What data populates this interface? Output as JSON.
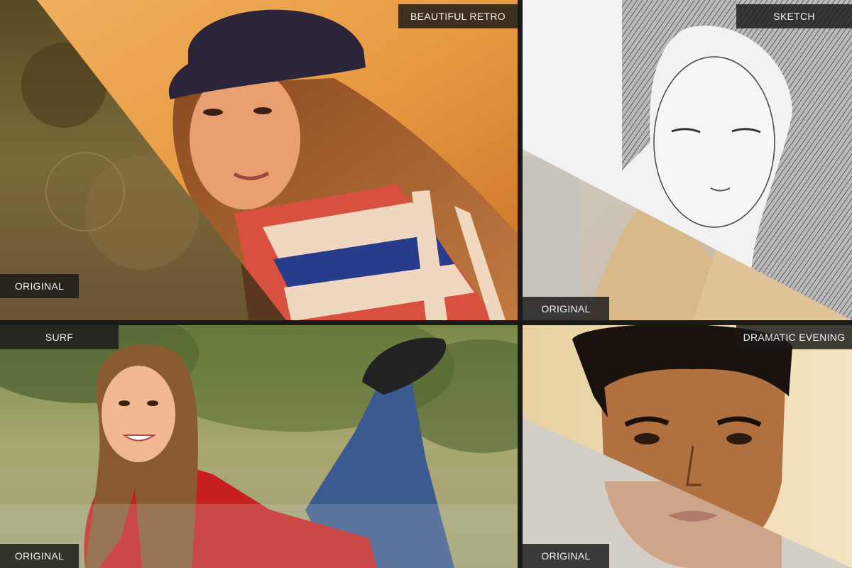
{
  "panels": [
    {
      "effect_label": "BEAUTIFUL RETRO",
      "original_label": "ORIGINAL"
    },
    {
      "effect_label": "SKETCH",
      "original_label": "ORIGINAL"
    },
    {
      "effect_label": "SURF",
      "original_label": "ORIGINAL"
    },
    {
      "effect_label": "DRAMATIC EVENING",
      "original_label": "ORIGINAL"
    }
  ]
}
